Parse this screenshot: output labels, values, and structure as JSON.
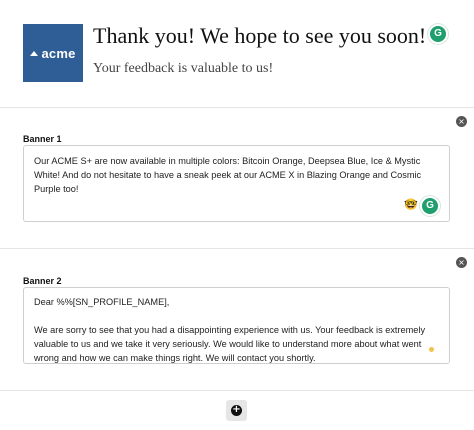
{
  "header": {
    "logo_text": "acme",
    "title": "Thank you! We hope to see you soon!",
    "subtitle": "Your feedback is valuable to us!",
    "badge_letter": "G"
  },
  "banners": [
    {
      "label": "Banner 1",
      "text": "Our ACME S+ are now available in multiple colors: Bitcoin Orange, Deepsea Blue, Ice & Mystic White! And do not hesitate to have a sneak peek at our ACME X in Blazing Orange and Cosmic Purple too!",
      "emoji": "🤓",
      "badge_letter": "G",
      "close": "×"
    },
    {
      "label": "Banner 2",
      "text": "Dear %%[SN_PROFILE_NAME],\n\nWe are sorry to see that you had a disappointing experience with us. Your feedback is extremely valuable to us and we take it very seriously. We would like to understand more about what went wrong and how we can make things right. We will contact you shortly.",
      "close": "×"
    }
  ],
  "add_button": {
    "symbol": "+"
  },
  "colors": {
    "brand": "#2f5d96",
    "grammarly": "#1f9e6e"
  }
}
